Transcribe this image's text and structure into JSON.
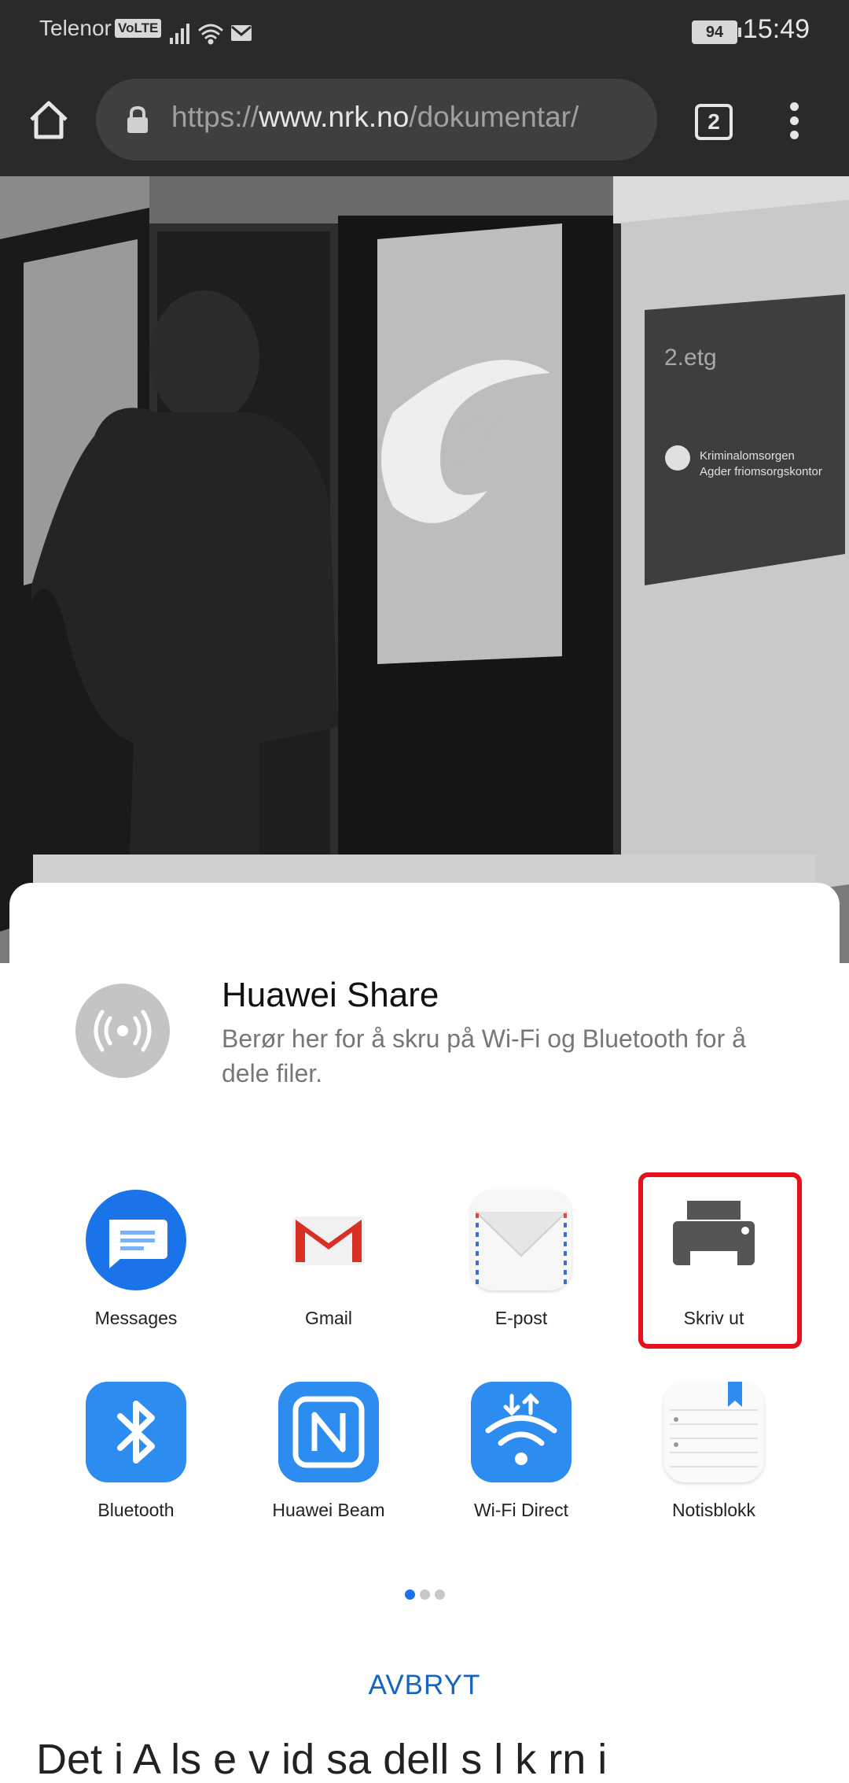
{
  "status_bar": {
    "carrier": "Telenor",
    "volte": "VoLTE",
    "battery": "94",
    "time": "15:49",
    "icons": [
      "signal-icon",
      "wifi-icon",
      "gmail-notification-icon"
    ]
  },
  "browser": {
    "url_scheme": "https://",
    "url_host": "www.nrk.no",
    "url_path": "/dokumentar/",
    "tab_count": "2"
  },
  "photo_signage": {
    "floor_label": "2.etg",
    "sign_line1": "Kriminalomsorgen",
    "sign_line2": "Agder friomsorgskontor"
  },
  "page_text_below": "Det  i  A   ls    e   v  id   sa   dell  s  l  k   rn  i",
  "share_sheet": {
    "huawei_share": {
      "title": "Huawei Share",
      "description": "Berør her for å skru på Wi-Fi og Bluetooth for å dele filer."
    },
    "apps": [
      {
        "label": "Messages",
        "icon": "messages-icon"
      },
      {
        "label": "Gmail",
        "icon": "gmail-icon"
      },
      {
        "label": "E-post",
        "icon": "email-icon"
      },
      {
        "label": "Skriv ut",
        "icon": "printer-icon"
      },
      {
        "label": "Bluetooth",
        "icon": "bluetooth-icon"
      },
      {
        "label": "Huawei Beam",
        "icon": "nfc-icon"
      },
      {
        "label": "Wi-Fi Direct",
        "icon": "wifi-direct-icon"
      },
      {
        "label": "Notisblokk",
        "icon": "notepad-icon"
      }
    ],
    "page_indicator": {
      "pages": 3,
      "current": 1
    },
    "cancel_label": "AVBRYT",
    "highlight_color": "#e8101b"
  }
}
